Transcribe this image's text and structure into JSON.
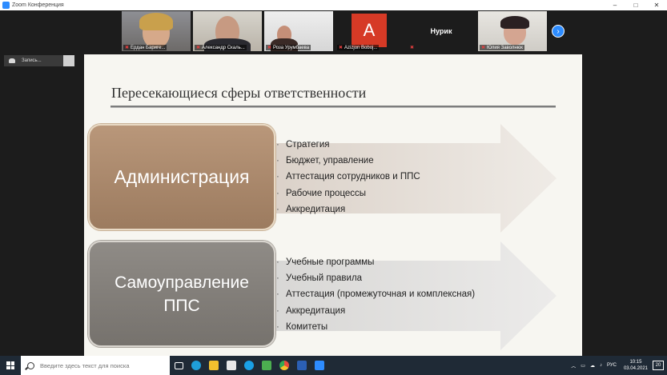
{
  "window": {
    "title": "Zoom Конференция",
    "minimize": "–",
    "maximize": "□",
    "close": "✕"
  },
  "gallery": {
    "participants": [
      {
        "name": "Ердан Бариге...",
        "muted": true,
        "type": "video"
      },
      {
        "name": "Александр Скаль...",
        "muted": true,
        "type": "video"
      },
      {
        "name": "Роза Урумбаева",
        "muted": true,
        "type": "video"
      },
      {
        "name": "Azizjon Boboj...",
        "muted": true,
        "type": "avatar",
        "letter": "A"
      },
      {
        "name": "Нурик",
        "muted": true,
        "type": "name"
      },
      {
        "name": "Юлия Заволнюк",
        "muted": true,
        "type": "video"
      }
    ],
    "next_icon": "›"
  },
  "recording": {
    "label": "Запись..."
  },
  "slide": {
    "title": "Пересекающиеся сферы ответственности",
    "sections": [
      {
        "heading_lines": [
          "Администрация"
        ],
        "color": "#a98a6e",
        "items": [
          "Стратегия",
          "Бюджет, управление",
          "Аттестация сотрудников и ППС",
          "Рабочие процессы",
          "Аккредитация"
        ]
      },
      {
        "heading_lines": [
          "Самоуправление",
          "ППС"
        ],
        "color": "#84807b",
        "items": [
          "Учебные программы",
          "Учебный правила",
          "Аттестация (промежуточная и комплексная)",
          "Аккредитация",
          "Комитеты"
        ]
      }
    ]
  },
  "taskbar": {
    "search_placeholder": "Введите здесь текст для поиска",
    "apps": [
      {
        "name": "task-view",
        "color": "#ffffff"
      },
      {
        "name": "edge",
        "color": "#1f9fd9"
      },
      {
        "name": "file-explorer",
        "color": "#f2c12e"
      },
      {
        "name": "store",
        "color": "#e8e8e8"
      },
      {
        "name": "skype",
        "color": "#1aa0e6"
      },
      {
        "name": "app-green",
        "color": "#4caf50"
      },
      {
        "name": "chrome",
        "color": "#e84a3b"
      },
      {
        "name": "word",
        "color": "#2b5fb4"
      },
      {
        "name": "zoom",
        "color": "#2d8cff"
      }
    ],
    "tray": {
      "language": "РУС",
      "time": "10:15",
      "date": "03.04.2021",
      "notifications": "20"
    }
  }
}
